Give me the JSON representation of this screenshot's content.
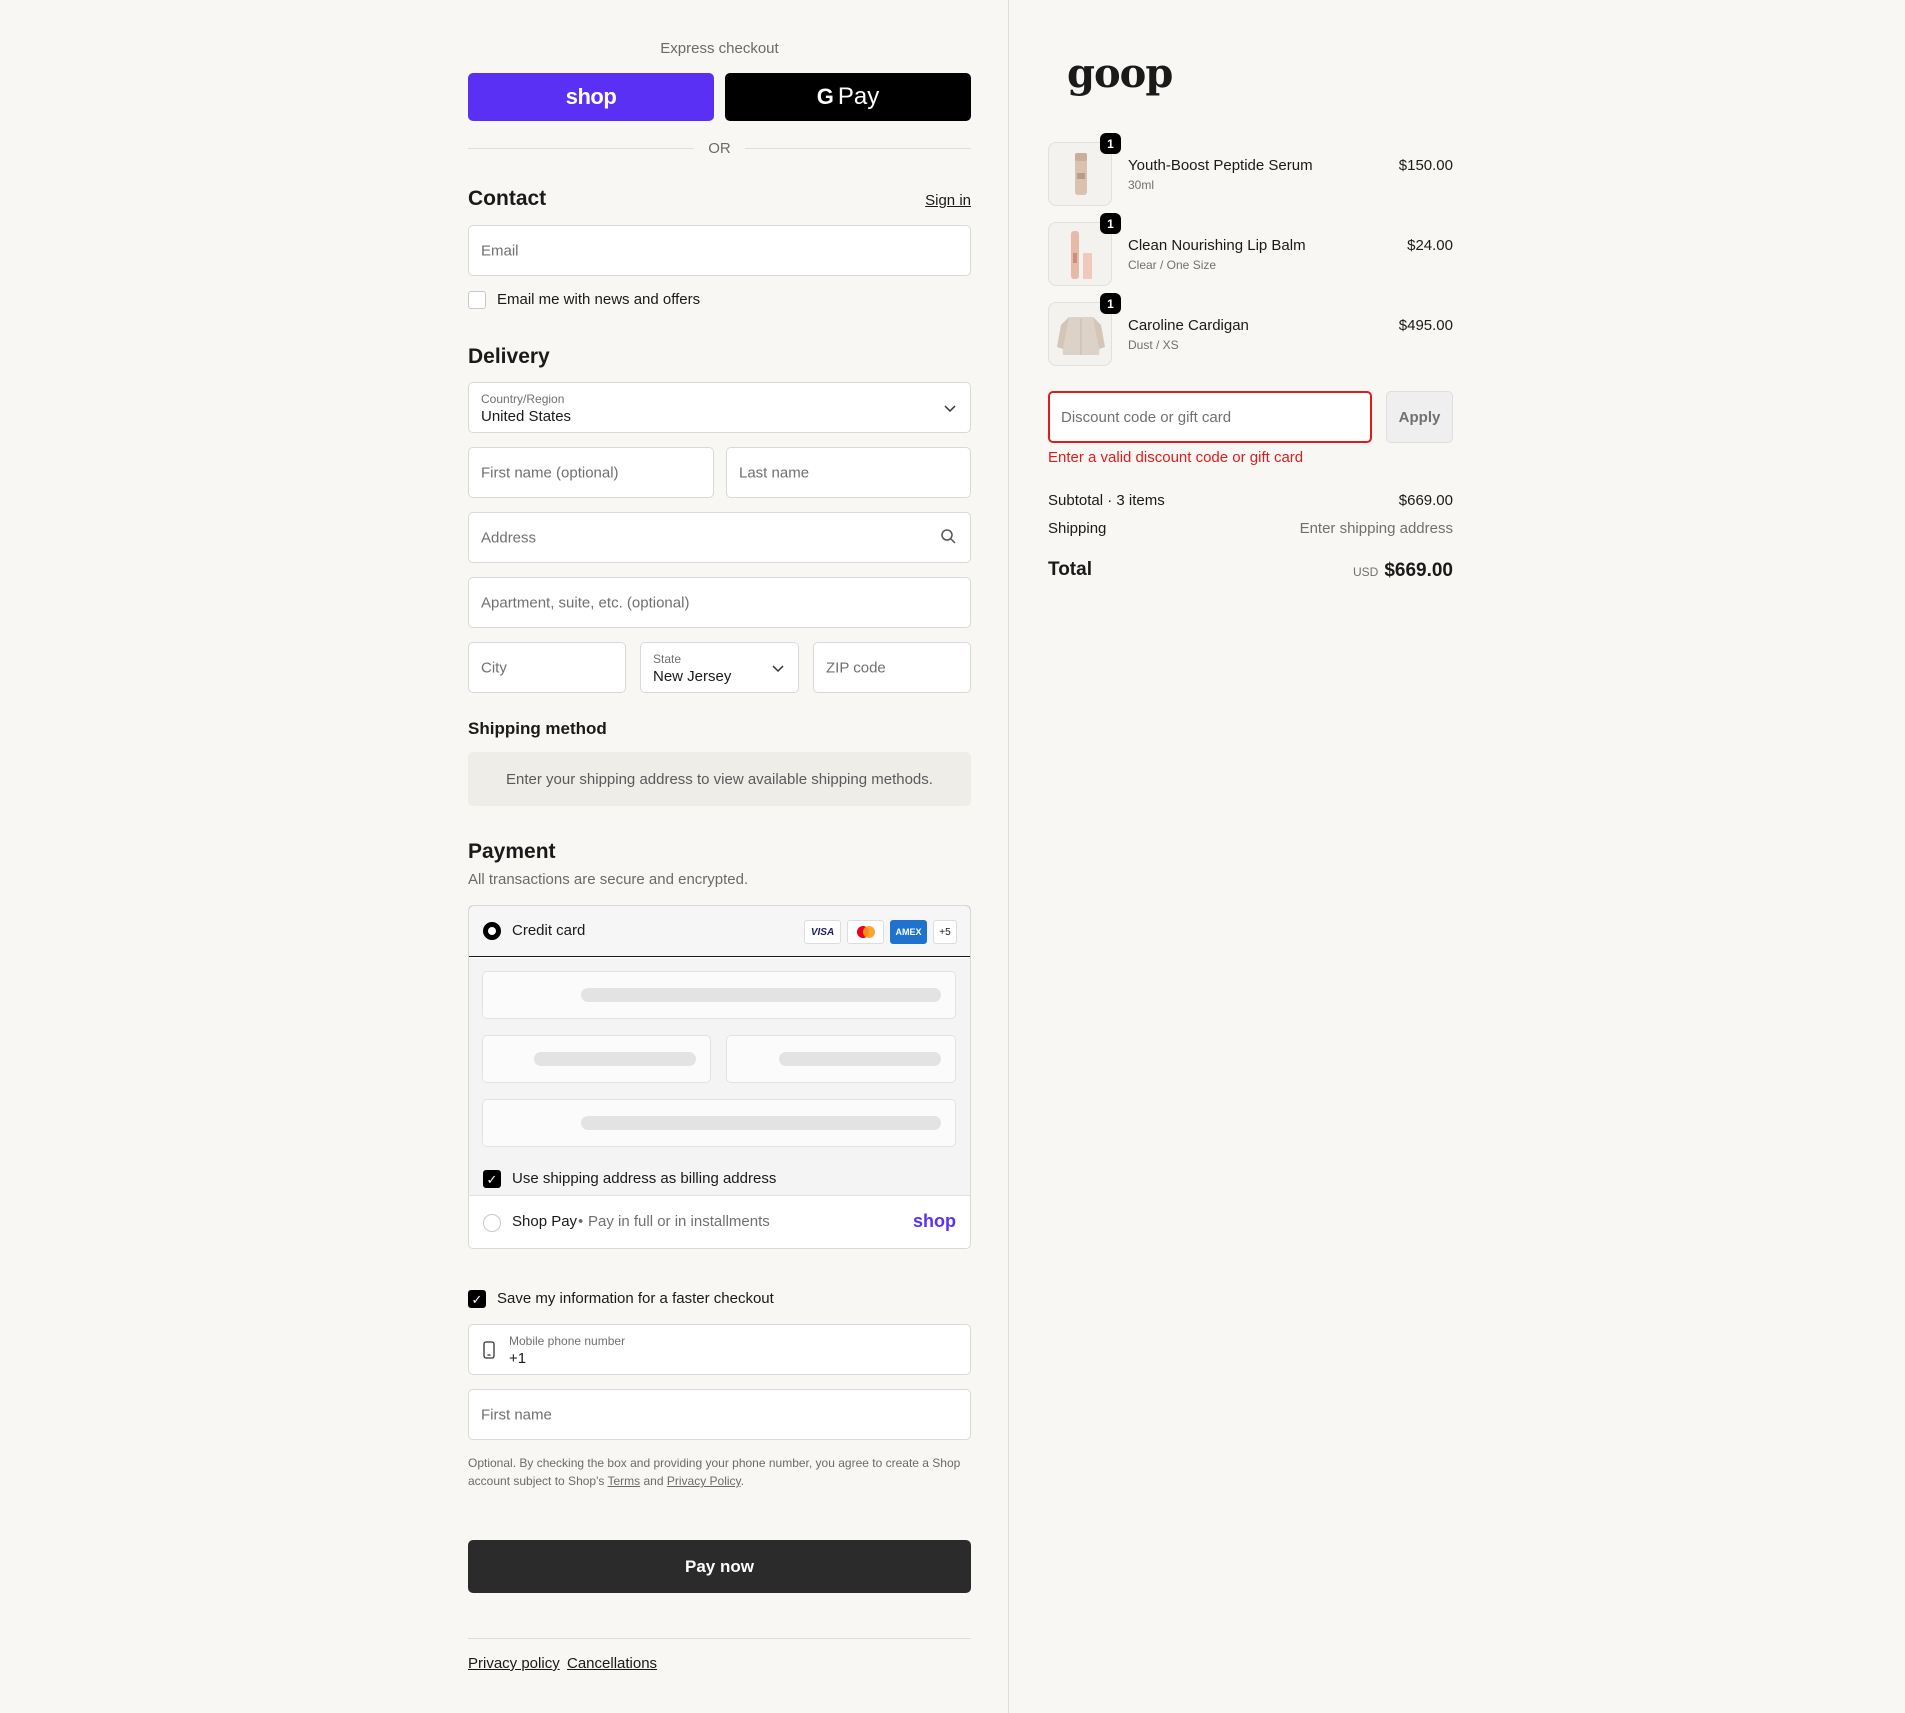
{
  "express": {
    "title": "Express checkout",
    "shop_label": "shop",
    "gpay_label": "Pay",
    "gpay_g": "G",
    "or": "OR"
  },
  "contact": {
    "title": "Contact",
    "sign_in": "Sign in",
    "email_placeholder": "Email",
    "news_label": "Email me with news and offers",
    "news_checked": false
  },
  "delivery": {
    "title": "Delivery",
    "country_label": "Country/Region",
    "country_value": "United States",
    "first_name_placeholder": "First name (optional)",
    "last_name_placeholder": "Last name",
    "address_placeholder": "Address",
    "apt_placeholder": "Apartment, suite, etc. (optional)",
    "city_placeholder": "City",
    "state_label": "State",
    "state_value": "New Jersey",
    "zip_placeholder": "ZIP code"
  },
  "shipping_method": {
    "title": "Shipping method",
    "message": "Enter your shipping address to view available shipping methods."
  },
  "payment": {
    "title": "Payment",
    "subtitle": "All transactions are secure and encrypted.",
    "credit_card_label": "Credit card",
    "card_brands": [
      "VISA",
      "MC",
      "AMEX",
      "+5"
    ],
    "billing_label": "Use shipping address as billing address",
    "billing_checked": true,
    "shop_pay_label": "Shop Pay",
    "shop_pay_sep": "•",
    "shop_pay_desc": "Pay in full or in installments",
    "shop_pay_logo": "shop"
  },
  "save_info": {
    "label": "Save my information for a faster checkout",
    "checked": true,
    "phone_label": "Mobile phone number",
    "phone_value": "+1",
    "first_name_placeholder": "First name",
    "legal_pre": "Optional. By checking the box and providing your phone number, you agree to create a Shop account subject to Shop's ",
    "terms": "Terms",
    "and": " and ",
    "privacy": "Privacy Policy",
    "legal_post": "."
  },
  "pay_now": "Pay now",
  "footer": {
    "privacy": "Privacy policy",
    "cancellations": "Cancellations"
  },
  "summary": {
    "logo": "goop",
    "items": [
      {
        "name": "Youth-Boost Peptide Serum",
        "variant": "30ml",
        "price": "$150.00",
        "qty": "1"
      },
      {
        "name": "Clean Nourishing Lip Balm",
        "variant": "Clear / One Size",
        "price": "$24.00",
        "qty": "1"
      },
      {
        "name": "Caroline Cardigan",
        "variant": "Dust / XS",
        "price": "$495.00",
        "qty": "1"
      }
    ],
    "discount_placeholder": "Discount code or gift card",
    "apply": "Apply",
    "discount_error": "Enter a valid discount code or gift card",
    "subtotal_label": "Subtotal · 3 items",
    "subtotal_value": "$669.00",
    "shipping_label": "Shipping",
    "shipping_value": "Enter shipping address",
    "total_label": "Total",
    "currency": "USD",
    "total_value": "$669.00"
  },
  "colors": {
    "shop_purple": "#5a31f4",
    "error_red": "#dd1d1d",
    "pay_button": "#2b2b2b"
  }
}
